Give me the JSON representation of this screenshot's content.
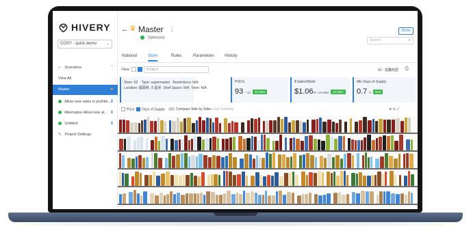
{
  "sidebar": {
    "logo": "HIVERY",
    "store_select": "COSY - quick demo",
    "items": [
      {
        "icon": "scenario-icon",
        "label": "Scenarios",
        "right": "⌃"
      },
      {
        "icon": "",
        "label": "View All",
        "right": ""
      },
      {
        "icon": "",
        "label": "Master",
        "right": "★"
      },
      {
        "icon": "check-dot",
        "label": "Allow new sales in prohibi...",
        "right": "⬇"
      },
      {
        "icon": "check-dot",
        "label": "Alternative Allow new al...",
        "right": "⬇"
      },
      {
        "icon": "check-dot",
        "label": "Untitled",
        "right": "⬇"
      },
      {
        "icon": "settings-icon",
        "label": "Project Settings",
        "right": ""
      }
    ]
  },
  "header": {
    "title": "Master",
    "status": "Optimized",
    "done_label": "Done",
    "search_placeholder": "Search"
  },
  "tabs": [
    "National",
    "Store",
    "Rules",
    "Parameters",
    "History"
  ],
  "active_tab": "Store",
  "view": {
    "label": "View",
    "product_placeholder": "Product",
    "page_info": "62 - 佐藤商店"
  },
  "metrics": {
    "store_info": {
      "store": "Store: 62",
      "type": "Type: supermarket",
      "restrictions": "Restrictions: N/A",
      "location": "Location: 福岡県, 久留米",
      "shelf_space": "Shelf Space: N/A",
      "town": "Town: N/A"
    },
    "pod": {
      "label": "POD's",
      "value": "93",
      "delta": "+10",
      "pill": "12.05%"
    },
    "sales": {
      "label": "$ Sales/Week",
      "value": "$1.06",
      "sub": "M +13.06M",
      "pill": "12.05%"
    },
    "mindays": {
      "label": "Min Days of Supply",
      "value": "0.7",
      "delta": "0",
      "pill": "Null"
    }
  },
  "filters": {
    "price": "Price",
    "days_supply": "Days of Supply",
    "compare": "Compare Side by Side",
    "lock": "Lock Scrolling"
  },
  "colors": {
    "accent": "#2f7fd8",
    "success": "#3fb950",
    "star": "#f5a623"
  }
}
